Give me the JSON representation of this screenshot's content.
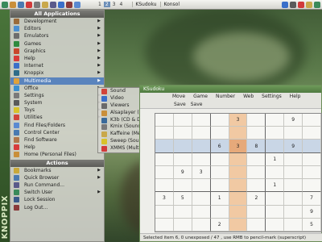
{
  "taskbar": {
    "desktops": [
      "1",
      "2",
      "3",
      "4"
    ],
    "active_desktop": 1,
    "tasks": [
      "KSudoku",
      "Konsol"
    ],
    "tray_icons": [
      "network-icon",
      "speaker-icon",
      "flag-icon",
      "clipboard-icon",
      "updates-icon"
    ]
  },
  "side_brand": "KNOPPIX",
  "menu": {
    "header": "All Applications",
    "items": [
      {
        "label": "Development",
        "icon": "development-icon",
        "color": "#9b6b3a",
        "arrow": true
      },
      {
        "label": "Editors",
        "icon": "editors-icon",
        "color": "#4b8fd1",
        "arrow": true
      },
      {
        "label": "Emulators",
        "icon": "emulators-icon",
        "color": "#6d6d6d",
        "arrow": true
      },
      {
        "label": "Games",
        "icon": "games-icon",
        "color": "#2f8a3f",
        "arrow": true
      },
      {
        "label": "Graphics",
        "icon": "graphics-icon",
        "color": "#c9462d",
        "arrow": true
      },
      {
        "label": "Help",
        "icon": "help-icon",
        "color": "#d83a3a",
        "arrow": true
      },
      {
        "label": "Internet",
        "icon": "internet-icon",
        "color": "#3a6fc9",
        "arrow": true
      },
      {
        "label": "Knoppix",
        "icon": "knoppix-icon",
        "color": "#2f6d8a",
        "arrow": true
      },
      {
        "label": "Multimedia",
        "icon": "multimedia-icon",
        "color": "#e0a23a",
        "arrow": true
      },
      {
        "label": "Office",
        "icon": "office-icon",
        "color": "#3a8fd1",
        "arrow": true
      },
      {
        "label": "Settings",
        "icon": "settings-icon",
        "color": "#7a7a7a",
        "arrow": true
      },
      {
        "label": "System",
        "icon": "system-icon",
        "color": "#5a5a5a",
        "arrow": true
      },
      {
        "label": "Toys",
        "icon": "toys-icon",
        "color": "#d8c22a",
        "arrow": true
      },
      {
        "label": "Utilities",
        "icon": "utilities-icon",
        "color": "#d1443a",
        "arrow": true
      },
      {
        "label": "Find Files/Folders",
        "icon": "find-files-icon",
        "color": "#5a8ad1",
        "arrow": false
      },
      {
        "label": "Control Center",
        "icon": "control-center-icon",
        "color": "#4a7ab1",
        "arrow": false
      },
      {
        "label": "Find Software",
        "icon": "find-software-icon",
        "color": "#b1764a",
        "arrow": false
      },
      {
        "label": "Help",
        "icon": "help-icon",
        "color": "#d83a3a",
        "arrow": false
      },
      {
        "label": "Home (Personal Files)",
        "icon": "home-icon",
        "color": "#c98f3a",
        "arrow": false
      }
    ],
    "highlighted_index": 8,
    "actions_header": "Actions",
    "actions": [
      {
        "label": "Bookmarks",
        "icon": "bookmarks-icon",
        "color": "#c9a83a",
        "arrow": true
      },
      {
        "label": "Quick Browser",
        "icon": "quick-browser-icon",
        "color": "#4a7ab1",
        "arrow": true
      },
      {
        "label": "Run Command...",
        "icon": "run-command-icon",
        "color": "#5a5a8a",
        "arrow": false
      },
      {
        "label": "Switch User",
        "icon": "switch-user-icon",
        "color": "#3a8a5a",
        "arrow": true
      },
      {
        "label": "Lock Session",
        "icon": "lock-icon",
        "color": "#3a5a8a",
        "arrow": false
      },
      {
        "label": "Log Out...",
        "icon": "logout-icon",
        "color": "#8a3a3a",
        "arrow": false
      }
    ]
  },
  "submenu": {
    "items": [
      {
        "label": "Sound",
        "icon": "sound-icon",
        "color": "#d1443a",
        "arrow": true
      },
      {
        "label": "Video",
        "icon": "video-icon",
        "color": "#3a6fc9",
        "arrow": true
      },
      {
        "label": "Viewers",
        "icon": "viewers-icon",
        "color": "#6a6a6a",
        "arrow": true
      },
      {
        "label": "Alsaplayer (Sound Player)",
        "icon": "alsaplayer-icon",
        "color": "#c98f3a",
        "arrow": false
      },
      {
        "label": "K3b (CD & DVD Burning)",
        "icon": "k3b-icon",
        "color": "#3a6a9a",
        "arrow": false
      },
      {
        "label": "Kmix (Sound Mixer)",
        "icon": "kmix-icon",
        "color": "#7a7a7a",
        "arrow": false
      },
      {
        "label": "Kaffeine (Media Player)",
        "icon": "kaffeine-icon",
        "color": "#c9a84a",
        "arrow": false
      },
      {
        "label": "Sweep (Sound Editor)",
        "icon": "sweep-icon",
        "color": "#d8c22a",
        "arrow": false
      },
      {
        "label": "XMMS (Multimedia Player)",
        "icon": "xmms-icon",
        "color": "#d13a3a",
        "arrow": false
      }
    ]
  },
  "ksudoku": {
    "title": "KSudoku",
    "menus": [
      "Move",
      "Game",
      "Number",
      "Web",
      "Settings",
      "Help"
    ],
    "toolbar": [
      "Save",
      "Save"
    ],
    "grid": [
      [
        "",
        "",
        "",
        "",
        "3",
        "",
        "",
        "9",
        ""
      ],
      [
        "",
        "",
        "",
        "",
        "",
        "",
        "",
        "",
        ""
      ],
      [
        "",
        "",
        "",
        "6",
        "3",
        "8",
        "",
        "9",
        ""
      ],
      [
        "",
        "",
        "",
        "",
        "",
        "",
        "1",
        "",
        ""
      ],
      [
        "",
        "9",
        "3",
        "",
        "",
        "",
        "",
        "",
        ""
      ],
      [
        "",
        "",
        "",
        "",
        "",
        "",
        "1",
        "",
        ""
      ],
      [
        "3",
        "5",
        "",
        "1",
        "",
        "2",
        "",
        "",
        "7"
      ],
      [
        "",
        "",
        "",
        "",
        "",
        "",
        "",
        "",
        "9"
      ],
      [
        "",
        "",
        "",
        "2",
        "",
        "",
        "",
        "",
        "5"
      ]
    ],
    "status": "Selected item 6, 0 unexposed / 47 , use RMB to pencil-mark (superscript)"
  }
}
